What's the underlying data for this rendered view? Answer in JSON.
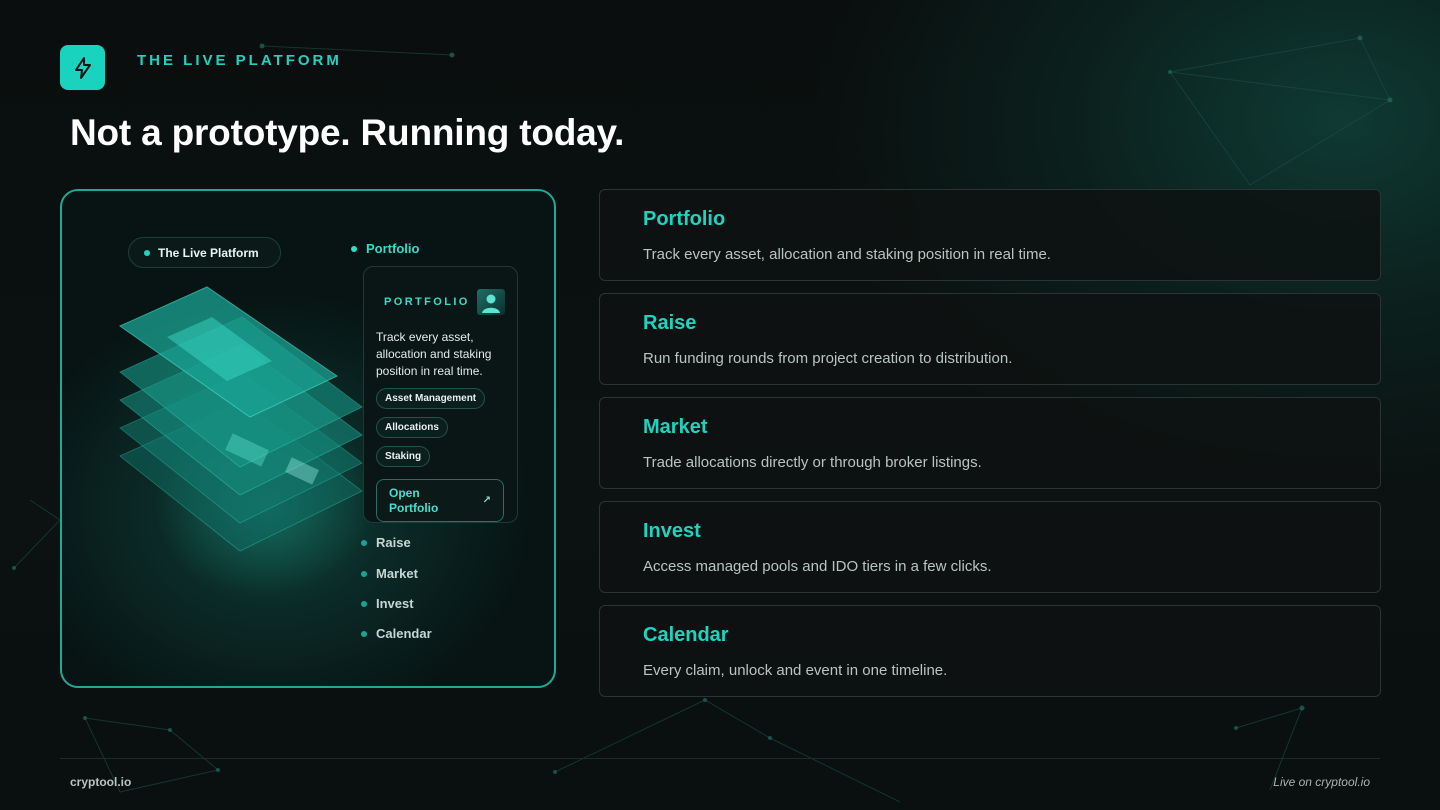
{
  "header": {
    "eyebrow": "THE LIVE PLATFORM",
    "title": "Not a prototype. Running today.",
    "logo_icon": "lightning-bolt-icon"
  },
  "screenshot": {
    "pill_label": "The Live Platform",
    "nav": [
      {
        "label": "Portfolio",
        "active": true
      },
      {
        "label": "Raise",
        "active": false
      },
      {
        "label": "Market",
        "active": false
      },
      {
        "label": "Invest",
        "active": false
      },
      {
        "label": "Calendar",
        "active": false
      }
    ],
    "card": {
      "heading": "PORTFOLIO",
      "description": "Track every asset, allocation and staking position in real time.",
      "tags": [
        "Asset Management",
        "Allocations",
        "Staking"
      ],
      "button_line1": "Open",
      "button_line2": "Portfolio",
      "button_icon": "arrow-up-right-icon"
    }
  },
  "features": [
    {
      "name": "Portfolio",
      "text": "Track every asset, allocation and staking position in real time."
    },
    {
      "name": "Raise",
      "text": "Run funding rounds from project creation to distribution."
    },
    {
      "name": "Market",
      "text": "Trade allocations directly or through broker listings."
    },
    {
      "name": "Invest",
      "text": "Access managed pools and IDO tiers in a few clicks."
    },
    {
      "name": "Calendar",
      "text": "Every claim, unlock and event in one timeline."
    }
  ],
  "footer": {
    "left": "cryptool.io",
    "right": "Live on cryptool.io"
  },
  "colors": {
    "accent": "#22d2c0",
    "background": "#0a0e0e",
    "card_border": "#2a3433"
  }
}
